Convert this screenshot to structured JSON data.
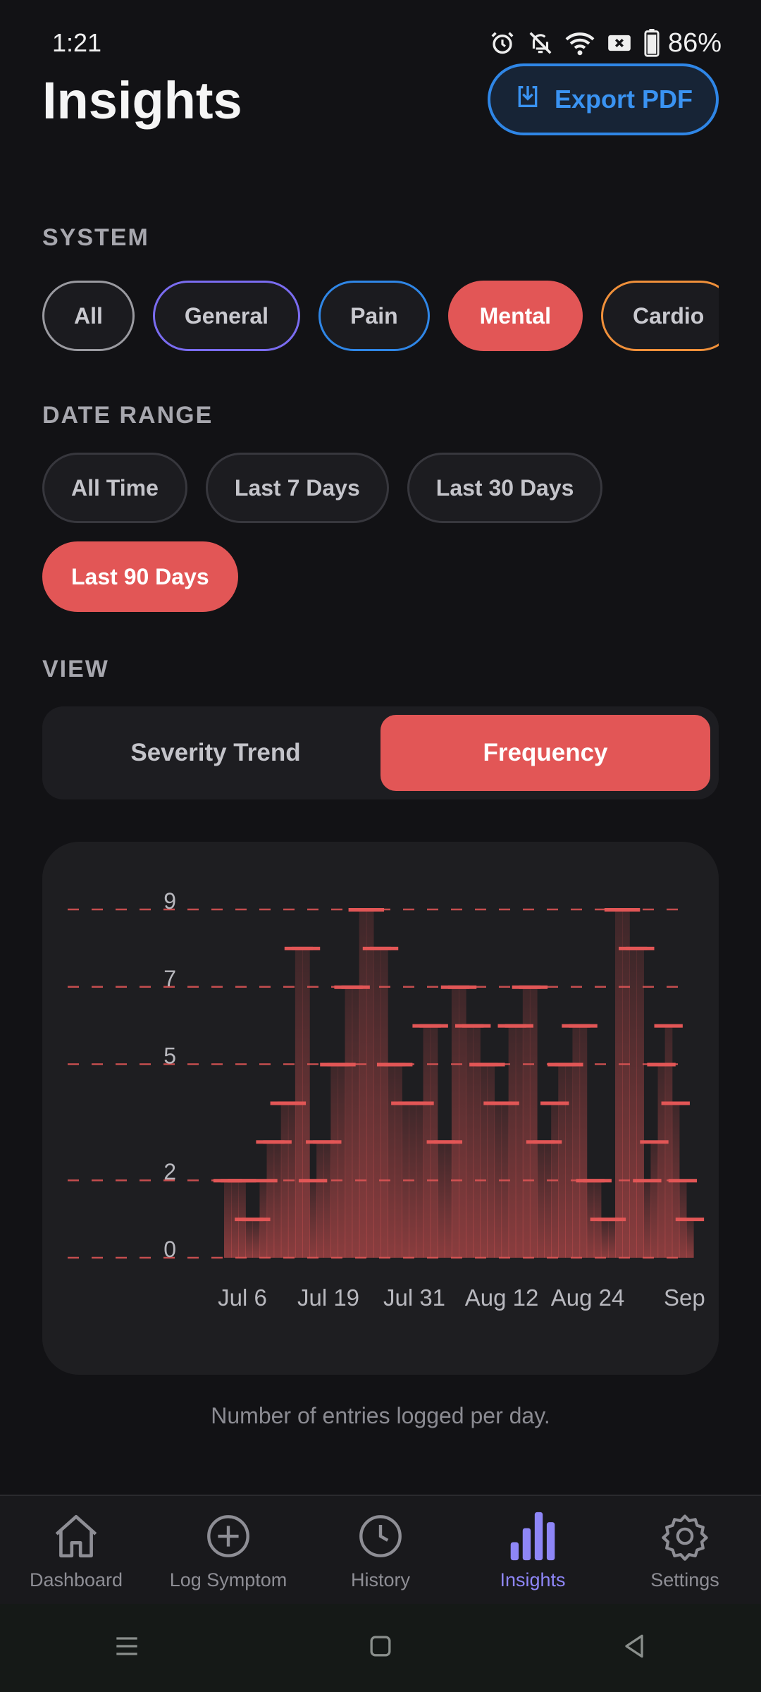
{
  "status_bar": {
    "time": "1:21",
    "battery": "86%"
  },
  "header": {
    "title": "Insights",
    "export_label": "Export PDF"
  },
  "system": {
    "label": "SYSTEM",
    "chips": [
      {
        "label": "All",
        "border": "#9a9aa0",
        "active": false
      },
      {
        "label": "General",
        "border": "#7a6cf0",
        "active": false
      },
      {
        "label": "Pain",
        "border": "#2f86e6",
        "active": false
      },
      {
        "label": "Mental",
        "border": "#e25656",
        "active": true
      },
      {
        "label": "Cardio",
        "border": "#f0903a",
        "active": false
      }
    ]
  },
  "date_range": {
    "label": "DATE RANGE",
    "options": [
      "All Time",
      "Last 7 Days",
      "Last 30 Days",
      "Last 90 Days"
    ],
    "selected": "Last 90 Days"
  },
  "view": {
    "label": "VIEW",
    "options": [
      "Severity Trend",
      "Frequency"
    ],
    "selected": "Frequency"
  },
  "chart_data": {
    "type": "area",
    "y_ticks": [
      "0",
      "2",
      "5",
      "7",
      "9"
    ],
    "x_ticks": [
      "Jul 6",
      "Jul 19",
      "Jul 31",
      "Aug 12",
      "Aug 24",
      "Sep"
    ],
    "ylim": [
      0,
      9
    ],
    "grid": true,
    "series_color": "#e25656",
    "values": [
      2,
      2,
      2,
      1,
      1,
      2,
      3,
      3,
      4,
      4,
      8,
      8,
      2,
      3,
      3,
      5,
      5,
      7,
      7,
      9,
      9,
      8,
      8,
      5,
      5,
      4,
      4,
      4,
      6,
      6,
      3,
      3,
      7,
      7,
      6,
      6,
      5,
      5,
      4,
      4,
      6,
      6,
      7,
      7,
      3,
      3,
      4,
      5,
      5,
      6,
      6,
      2,
      2,
      1,
      1,
      9,
      9,
      8,
      8,
      2,
      3,
      5,
      6,
      4,
      2,
      1
    ]
  },
  "caption": "Number of entries logged per day.",
  "bottom_nav": [
    {
      "label": "Dashboard",
      "icon": "home-icon",
      "active": false
    },
    {
      "label": "Log Symptom",
      "icon": "plus-circle-icon",
      "active": false
    },
    {
      "label": "History",
      "icon": "clock-icon",
      "active": false
    },
    {
      "label": "Insights",
      "icon": "bar-chart-icon",
      "active": true
    },
    {
      "label": "Settings",
      "icon": "gear-icon",
      "active": false
    }
  ]
}
